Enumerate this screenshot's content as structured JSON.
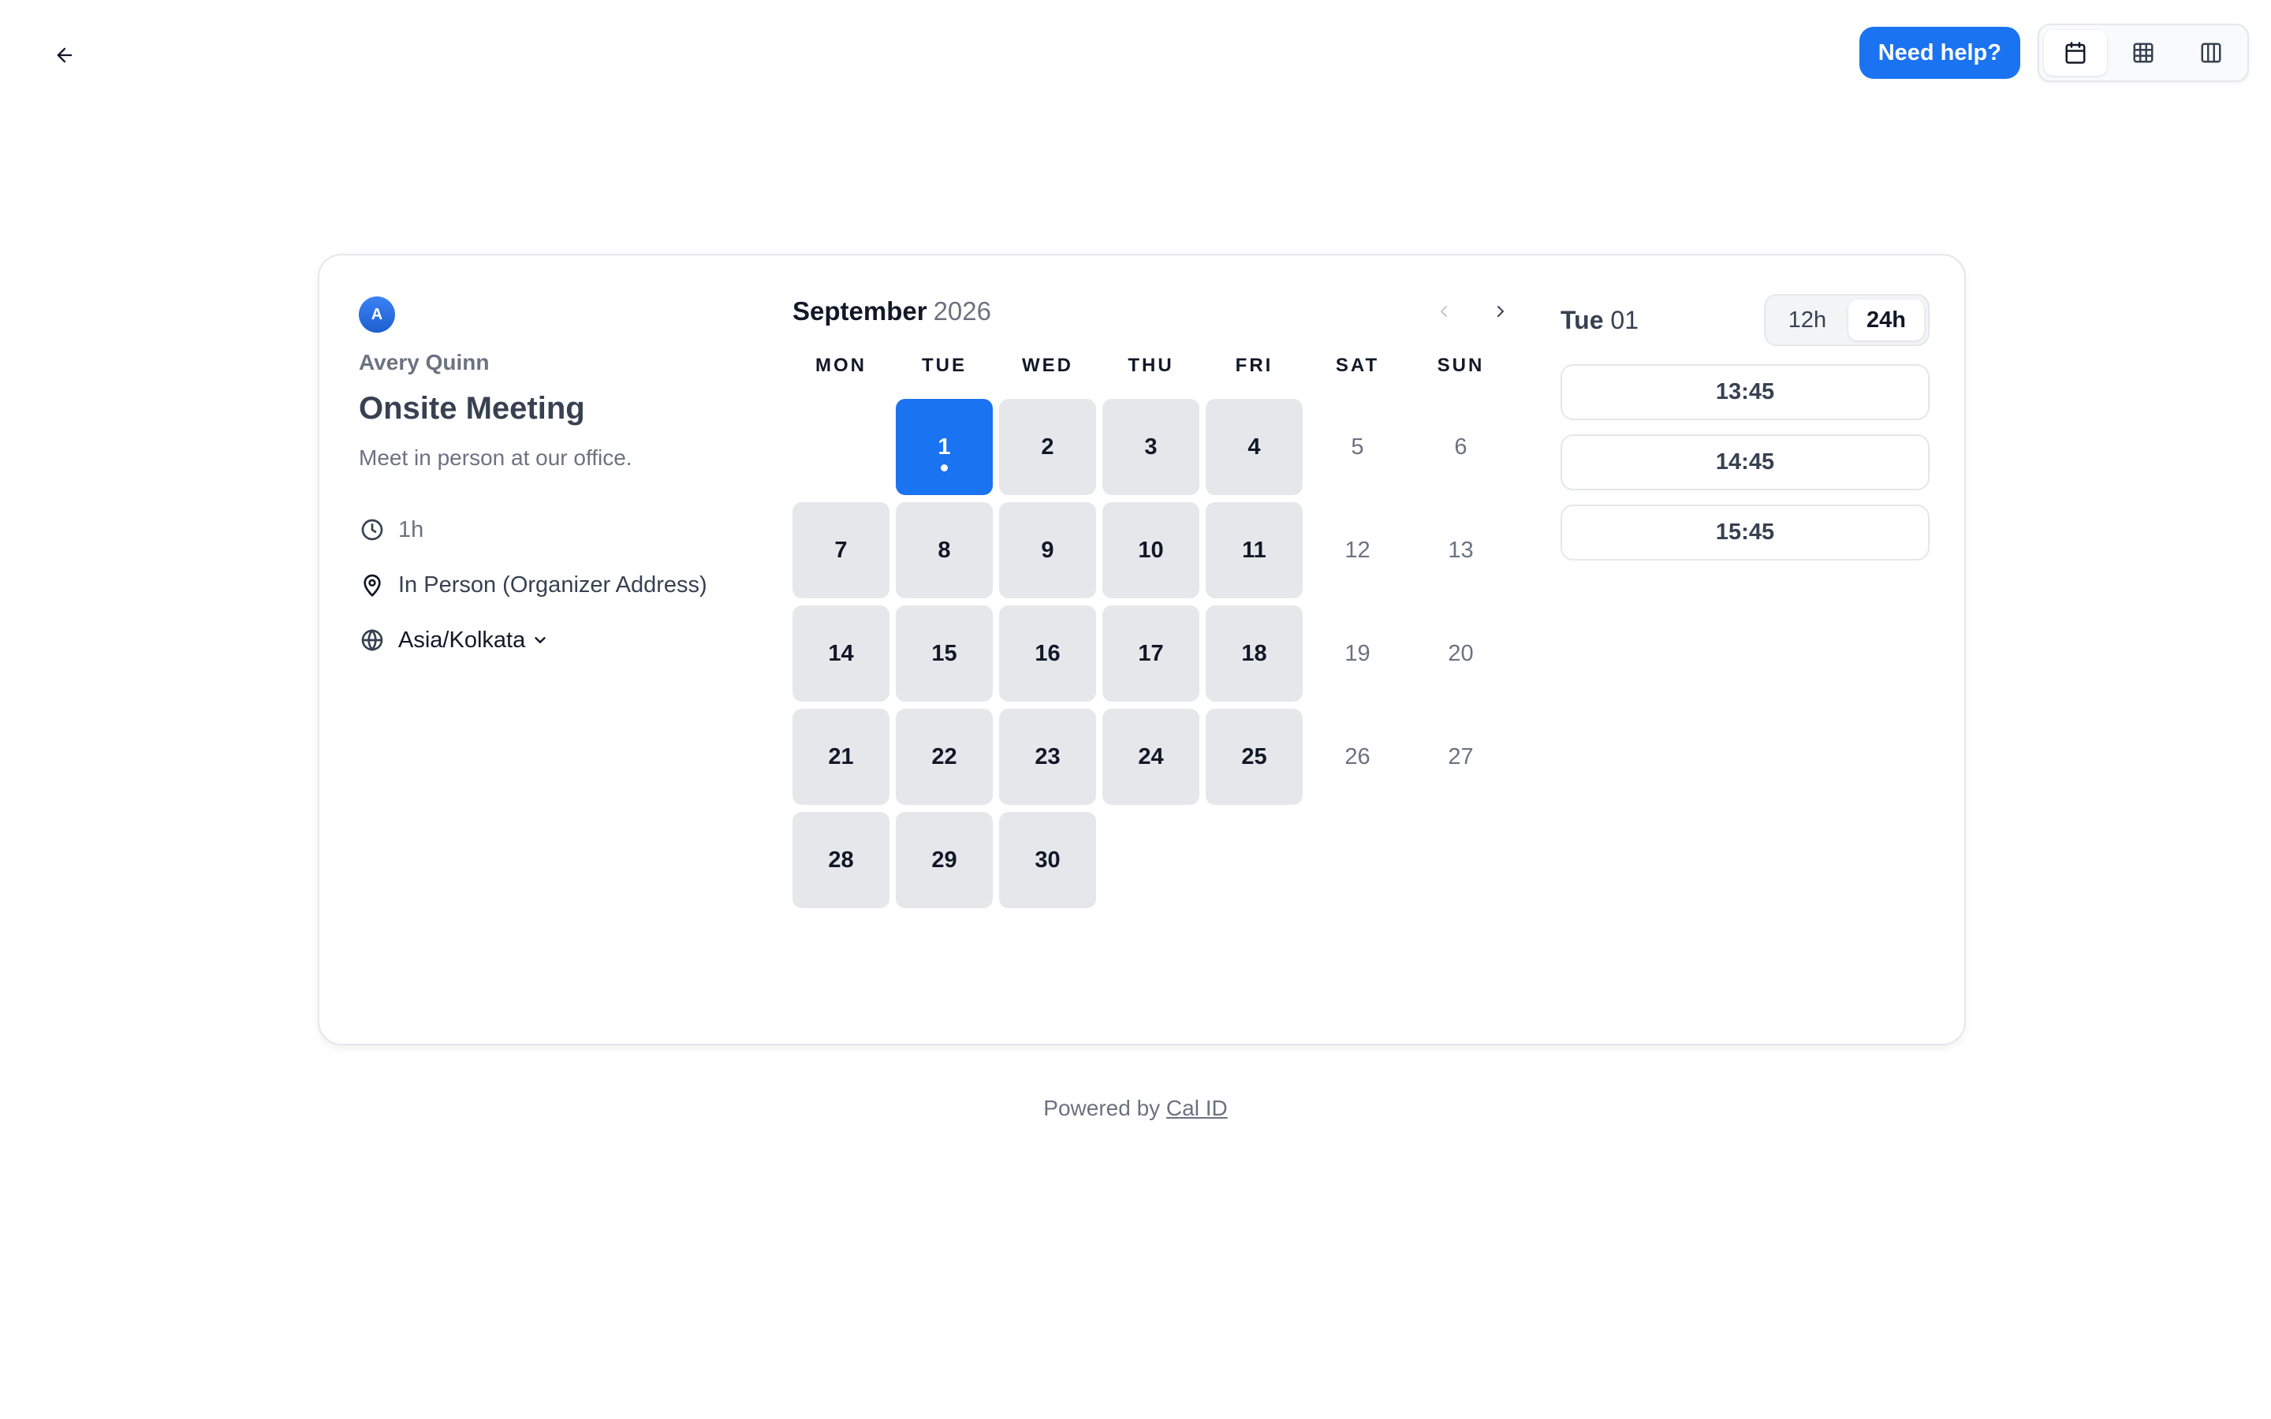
{
  "header": {
    "help_label": "Need help?"
  },
  "view_toggle": {
    "items": [
      {
        "name": "month-view",
        "icon": "calendar-icon",
        "active": true
      },
      {
        "name": "week-view",
        "icon": "grid-icon",
        "active": false
      },
      {
        "name": "column-view",
        "icon": "columns-icon",
        "active": false
      }
    ]
  },
  "event": {
    "avatar_initial": "A",
    "host": "Avery Quinn",
    "title": "Onsite Meeting",
    "description": "Meet in person at our office.",
    "duration": "1h",
    "location": "In Person (Organizer Address)",
    "timezone": "Asia/Kolkata"
  },
  "calendar": {
    "month": "September",
    "year": "2026",
    "weekdays": [
      "MON",
      "TUE",
      "WED",
      "THU",
      "FRI",
      "SAT",
      "SUN"
    ],
    "leading_blanks": 1,
    "days": [
      {
        "n": "1",
        "state": "selected"
      },
      {
        "n": "2",
        "state": "available"
      },
      {
        "n": "3",
        "state": "available"
      },
      {
        "n": "4",
        "state": "available"
      },
      {
        "n": "5",
        "state": "unavailable"
      },
      {
        "n": "6",
        "state": "unavailable"
      },
      {
        "n": "7",
        "state": "available"
      },
      {
        "n": "8",
        "state": "available"
      },
      {
        "n": "9",
        "state": "available"
      },
      {
        "n": "10",
        "state": "available"
      },
      {
        "n": "11",
        "state": "available"
      },
      {
        "n": "12",
        "state": "unavailable"
      },
      {
        "n": "13",
        "state": "unavailable"
      },
      {
        "n": "14",
        "state": "available"
      },
      {
        "n": "15",
        "state": "available"
      },
      {
        "n": "16",
        "state": "available"
      },
      {
        "n": "17",
        "state": "available"
      },
      {
        "n": "18",
        "state": "available"
      },
      {
        "n": "19",
        "state": "unavailable"
      },
      {
        "n": "20",
        "state": "unavailable"
      },
      {
        "n": "21",
        "state": "available"
      },
      {
        "n": "22",
        "state": "available"
      },
      {
        "n": "23",
        "state": "available"
      },
      {
        "n": "24",
        "state": "available"
      },
      {
        "n": "25",
        "state": "available"
      },
      {
        "n": "26",
        "state": "unavailable"
      },
      {
        "n": "27",
        "state": "unavailable"
      },
      {
        "n": "28",
        "state": "available"
      },
      {
        "n": "29",
        "state": "available"
      },
      {
        "n": "30",
        "state": "available"
      }
    ]
  },
  "slots_panel": {
    "day_label": "Tue",
    "day_num": "01",
    "format_12": "12h",
    "format_24": "24h",
    "active_format": "24h",
    "slots": [
      "13:45",
      "14:45",
      "15:45"
    ]
  },
  "footer": {
    "prefix": "Powered by ",
    "link": "Cal ID"
  },
  "colors": {
    "accent": "#1a73f0",
    "available_day": "#e5e7eb"
  }
}
